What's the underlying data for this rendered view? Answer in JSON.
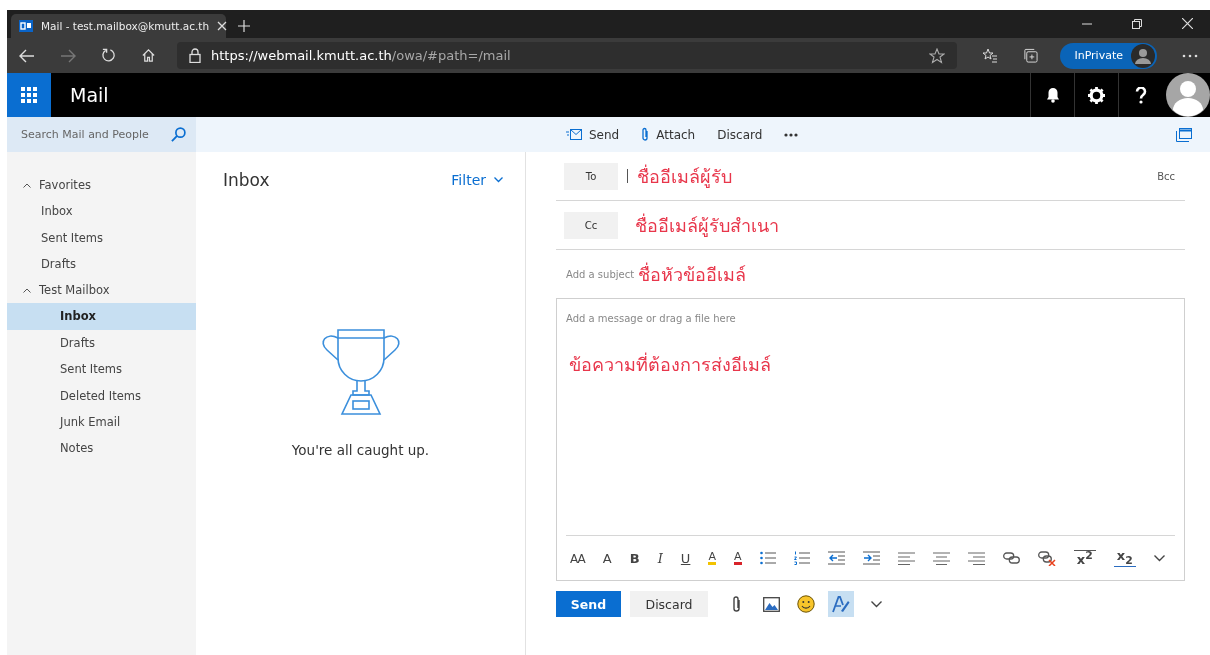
{
  "browser": {
    "tab_title": "Mail - test.mailbox@kmutt.ac.th",
    "url_host": "https://webmail.kmutt.ac.th",
    "url_path": "/owa/#path=/mail",
    "profile_label": "InPrivate"
  },
  "app": {
    "title": "Mail"
  },
  "search": {
    "placeholder": "Search Mail and People"
  },
  "command_bar": [
    {
      "kind": "send",
      "label": "Send"
    },
    {
      "kind": "attach",
      "label": "Attach"
    },
    {
      "kind": "discard",
      "label": "Discard"
    },
    {
      "kind": "more"
    }
  ],
  "sidebar": {
    "groups": [
      {
        "label": "Favorites",
        "expanded": true,
        "items": [
          {
            "label": "Inbox",
            "selected": false
          },
          {
            "label": "Sent Items",
            "selected": false
          },
          {
            "label": "Drafts",
            "selected": false
          }
        ]
      },
      {
        "label": "Test Mailbox",
        "expanded": true,
        "items": [
          {
            "label": "Inbox",
            "selected": true
          },
          {
            "label": "Drafts",
            "selected": false
          },
          {
            "label": "Sent Items",
            "selected": false
          },
          {
            "label": "Deleted Items",
            "selected": false
          },
          {
            "label": "Junk Email",
            "selected": false
          },
          {
            "label": "Notes",
            "selected": false
          }
        ]
      }
    ]
  },
  "list_pane": {
    "title": "Inbox",
    "filter": "Filter",
    "empty_message": "You're all caught up."
  },
  "compose": {
    "to_label": "To",
    "to_value": "ชื่ออีเมล์ผู้รับ",
    "bcc": "Bcc",
    "cc_label": "Cc",
    "cc_value": "ชื่ออีเมล์ผู้รับสำเนา",
    "subject_hint": "Add a subject",
    "subject_value": "ชื่อหัวข้ออีเมล์",
    "body_hint": "Add a message or drag a file here",
    "body_text": "ข้อความที่ต้องการส่งอีเมล์"
  },
  "format_toolbar": [
    {
      "kind": "font-size",
      "glyph": "AA"
    },
    {
      "kind": "grow-font",
      "glyph": "A"
    },
    {
      "kind": "bold",
      "glyph": "B"
    },
    {
      "kind": "italic",
      "glyph": "I"
    },
    {
      "kind": "underline",
      "glyph": "U"
    },
    {
      "kind": "highlight",
      "glyph": "A"
    },
    {
      "kind": "font-color",
      "glyph": "A"
    },
    {
      "kind": "bullets"
    },
    {
      "kind": "numbering"
    },
    {
      "kind": "outdent"
    },
    {
      "kind": "indent"
    },
    {
      "kind": "align-left"
    },
    {
      "kind": "align-center"
    },
    {
      "kind": "align-right"
    },
    {
      "kind": "link"
    },
    {
      "kind": "unlink"
    },
    {
      "kind": "superscript",
      "glyph": "x$^{2}$"
    },
    {
      "kind": "subscript",
      "glyph": "x$_{2}$"
    },
    {
      "kind": "more"
    }
  ],
  "actions": {
    "send": "Send",
    "discard": "Discard",
    "tools": [
      {
        "kind": "attach",
        "selected": false
      },
      {
        "kind": "image",
        "selected": false
      },
      {
        "kind": "emoji",
        "selected": false
      },
      {
        "kind": "format",
        "selected": true
      },
      {
        "kind": "more",
        "selected": false
      }
    ]
  }
}
